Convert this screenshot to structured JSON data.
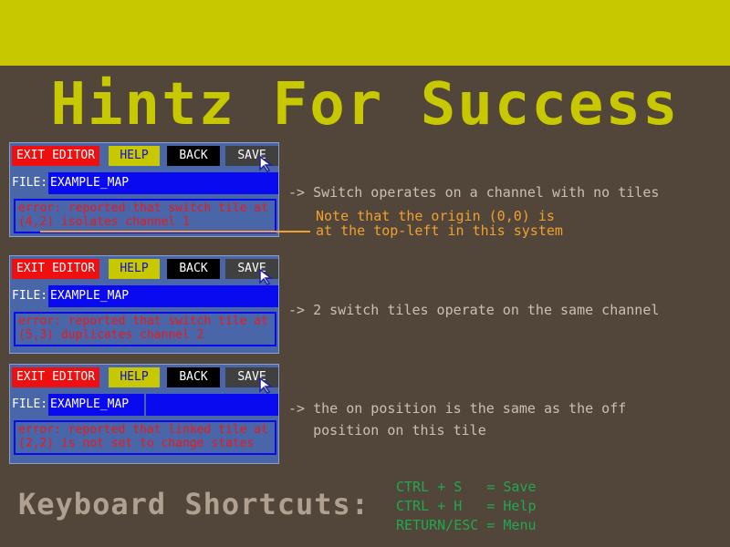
{
  "title": "Hintz For Success",
  "toolbar": {
    "exit_label": "EXIT EDITOR",
    "help_label": "HELP",
    "back_label": "BACK",
    "save_label": "SAVE"
  },
  "file_label": "FILE:",
  "panels": [
    {
      "filename": "EXAMPLE_MAP",
      "error_line1": "error: reported that switch tile at",
      "error_line2": "(4,2) isolates channel 1",
      "hint": "-> Switch operates on a channel with no tiles"
    },
    {
      "filename": "EXAMPLE_MAP",
      "error_line1": "error: reported that switch tile at",
      "error_line2": "(5,3) duplicates channel 2",
      "hint": "-> 2 switch tiles operate on the same channel"
    },
    {
      "filename": "EXAMPLE_MAP",
      "error_line1": "error: reported that linked tile at",
      "error_line2": "(2,2) is not set to change states",
      "hint_line1": "-> the on position is the same as the off",
      "hint_line2": "   position on this tile"
    }
  ],
  "origin_note": {
    "line1": "Note that the origin (0,0) is",
    "line2": "at the top-left in this system"
  },
  "shortcuts": {
    "title": "Keyboard Shortcuts:",
    "items": [
      "CTRL + S   = Save",
      "CTRL + H   = Help",
      "RETURN/ESC = Menu"
    ]
  },
  "colors": {
    "background": "#52463a",
    "accent_yellow": "#c8c800",
    "error_red": "#ee1818",
    "note_orange": "#f0a030",
    "shortcut_green": "#20a850"
  }
}
